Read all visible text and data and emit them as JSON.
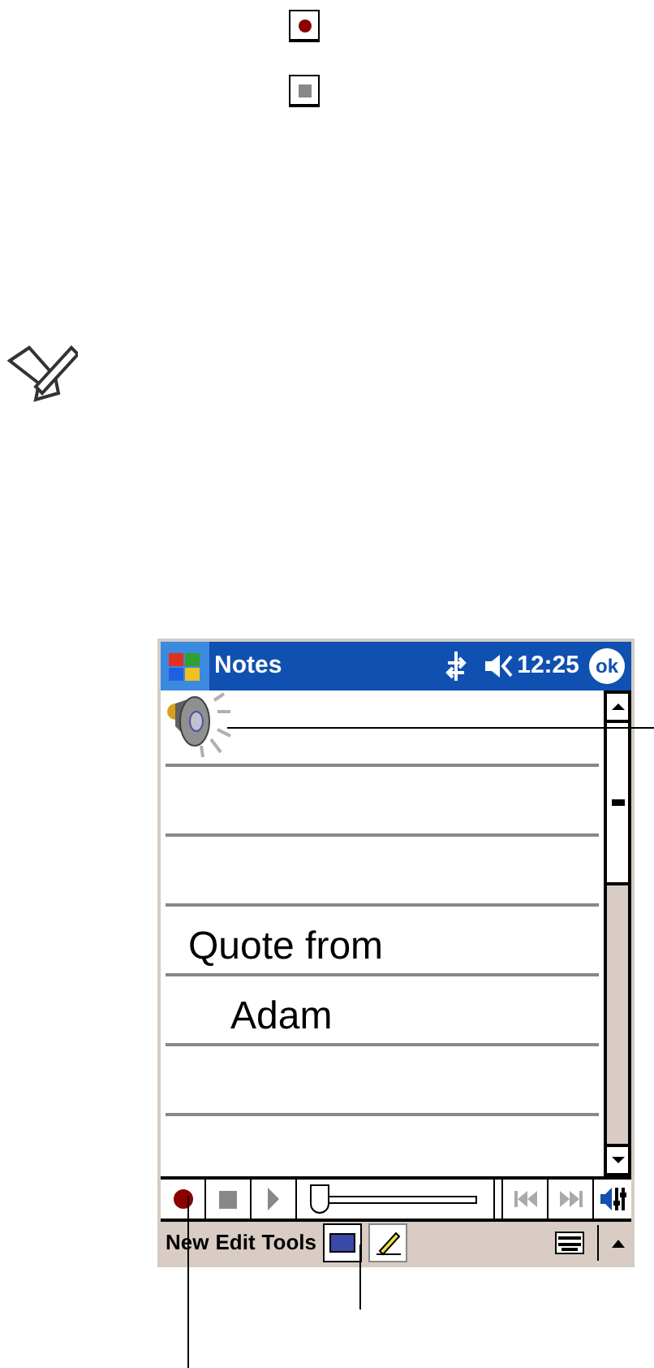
{
  "window": {
    "title": "Notes",
    "time": "12:25",
    "ok": "ok"
  },
  "note_lines": [
    "Quote from",
    "Adam"
  ],
  "recorder": {
    "level": 0.0
  },
  "menu": [
    "New",
    "Edit",
    "Tools"
  ],
  "input_modes": [
    {
      "kind": "keyboard",
      "selected": true
    },
    {
      "kind": "pen",
      "selected": false
    }
  ]
}
